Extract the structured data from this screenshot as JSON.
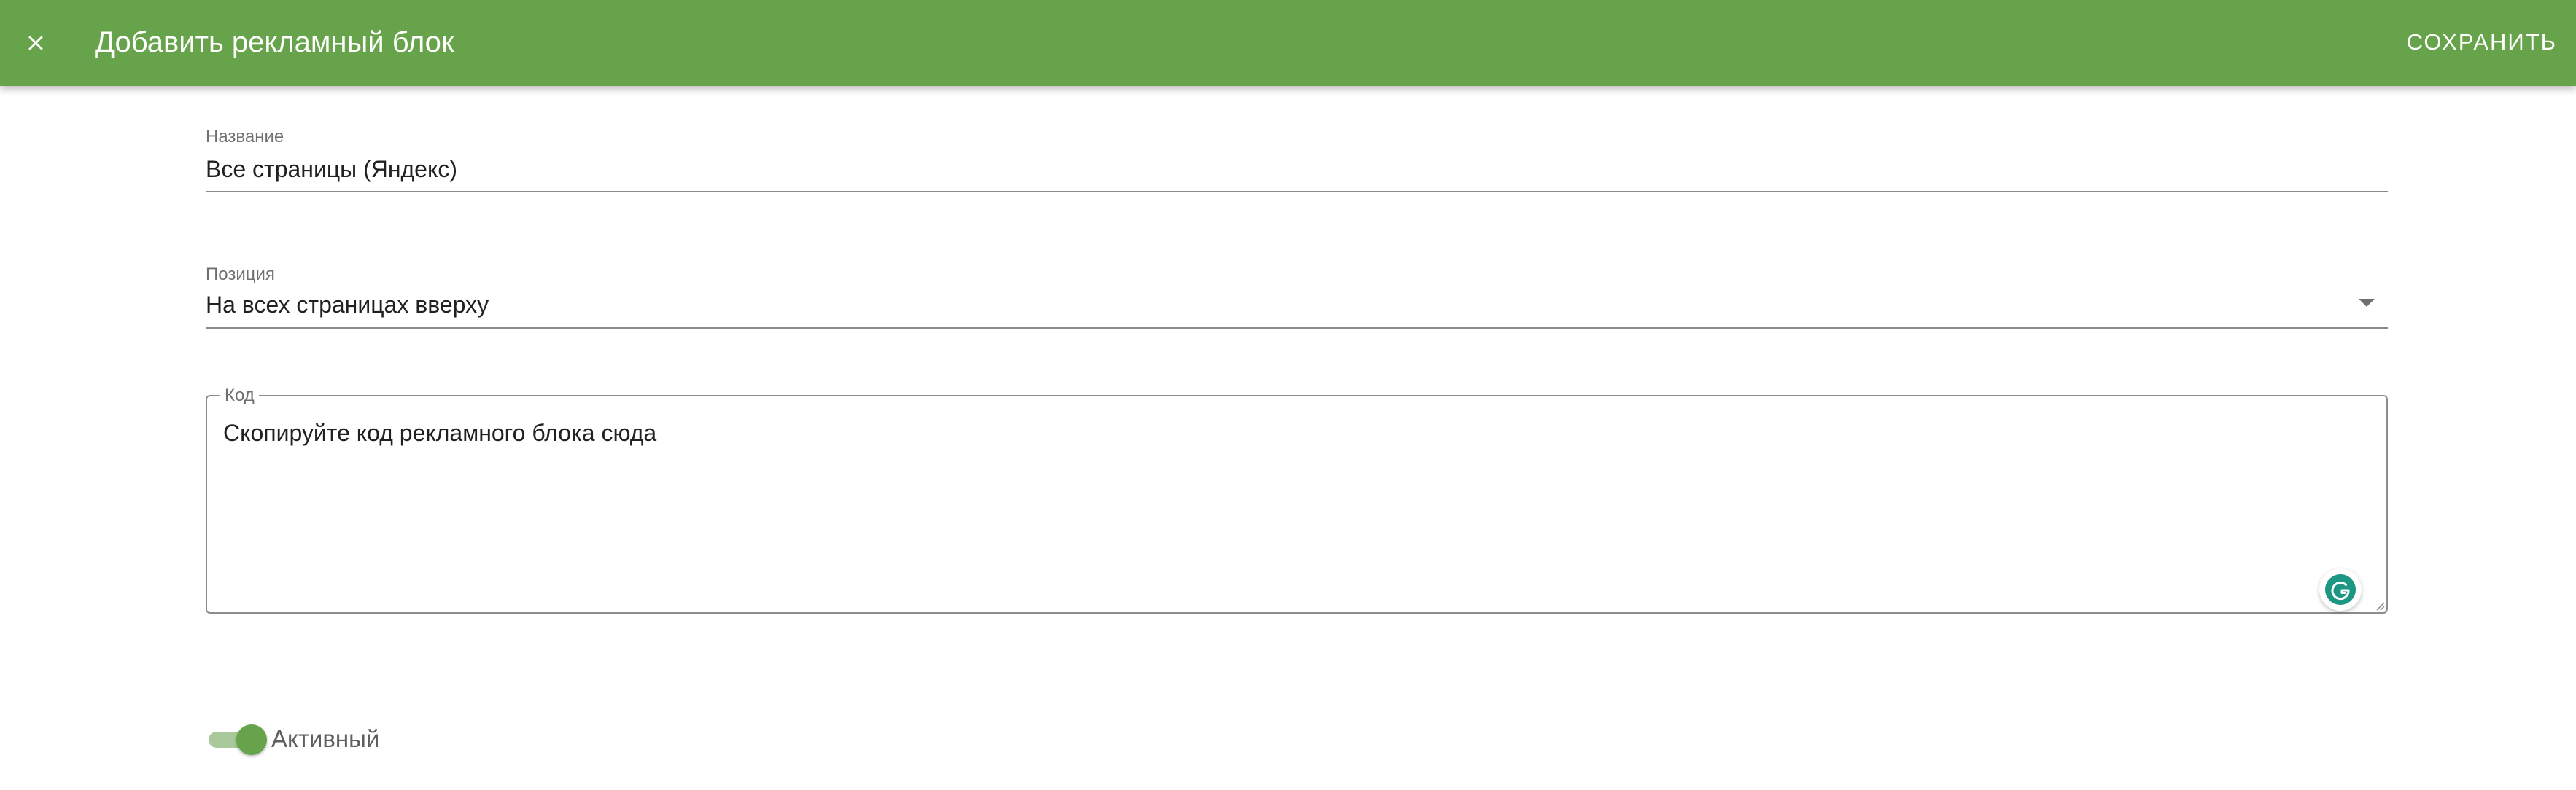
{
  "app_bar": {
    "title": "Добавить рекламный блок",
    "close_icon": "close-icon",
    "save_label": "СОХРАНИТЬ",
    "background_color": "#67a34a"
  },
  "form": {
    "name": {
      "label": "Название",
      "value": "Все страницы (Яндекс)"
    },
    "position": {
      "label": "Позиция",
      "selected": "На всех страницах вверху",
      "icon": "chevron-down-icon"
    },
    "code": {
      "label": "Код",
      "placeholder": "Скопируйте код рекламного блока сюда",
      "extension_icon": "grammarly-icon"
    },
    "active": {
      "label": "Активный",
      "checked": true,
      "accent_color": "#67a34a"
    }
  }
}
